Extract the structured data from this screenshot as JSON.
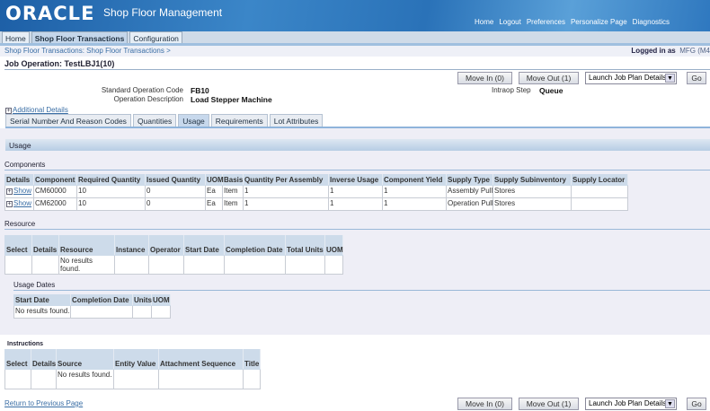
{
  "header": {
    "logo": "ORACLE",
    "app_title": "Shop Floor Management",
    "global_links": [
      "Home",
      "Logout",
      "Preferences",
      "Personalize Page",
      "Diagnostics"
    ]
  },
  "tabs": [
    {
      "label": "Home",
      "active": false
    },
    {
      "label": "Shop Floor Transactions",
      "active": true
    },
    {
      "label": "Configuration",
      "active": false
    }
  ],
  "breadcrumb": "Shop Floor Transactions: Shop Floor Transactions  >",
  "logged_in": {
    "label": "Logged in as",
    "user": "MFG (M4"
  },
  "page_title": "Job Operation: TestLBJ1(10)",
  "actions": {
    "move_in": "Move In (0)",
    "move_out": "Move Out (1)",
    "launch_select": "Launch Job Plan Details",
    "go": "Go"
  },
  "details": {
    "std_op_code_label": "Standard Operation Code",
    "std_op_code": "FB10",
    "op_desc_label": "Operation Description",
    "op_desc": "Load Stepper Machine",
    "intraop_label": "Intraop Step",
    "intraop": "Queue",
    "additional_details": "Additional Details"
  },
  "subtabs": [
    {
      "label": "Serial Number And Reason Codes"
    },
    {
      "label": "Quantities"
    },
    {
      "label": "Usage",
      "active": true
    },
    {
      "label": "Requirements"
    },
    {
      "label": "Lot Attributes"
    }
  ],
  "usage_header": "Usage",
  "components": {
    "title": "Components",
    "columns": [
      "Details",
      "Component",
      "Required Quantity",
      "Issued Quantity",
      "UOM",
      "Basis",
      "Quantity Per Assembly",
      "Inverse Usage",
      "Component Yield",
      "Supply Type",
      "Supply Subinventory",
      "Supply Locator"
    ],
    "rows": [
      {
        "details": "Show",
        "component": "CM60000",
        "required": "10",
        "issued": "0",
        "uom": "Ea",
        "basis": "Item",
        "qpa": "1",
        "inverse": "1",
        "yield": "1",
        "supply_type": "Assembly Pull",
        "subinv": "Stores",
        "locator": ""
      },
      {
        "details": "Show",
        "component": "CM62000",
        "required": "10",
        "issued": "0",
        "uom": "Ea",
        "basis": "Item",
        "qpa": "1",
        "inverse": "1",
        "yield": "1",
        "supply_type": "Operation Pull",
        "subinv": "Stores",
        "locator": ""
      }
    ]
  },
  "resource": {
    "title": "Resource",
    "columns": [
      "Select",
      "Details",
      "Resource",
      "Instance",
      "Operator",
      "Start Date",
      "Completion Date",
      "Total Units",
      "UOM"
    ],
    "empty": "No results found."
  },
  "usage_dates": {
    "title": "Usage Dates",
    "columns": [
      "Start Date",
      "Completion Date",
      "Units",
      "UOM"
    ],
    "empty": "No results found."
  },
  "instructions": {
    "title": "Instructions",
    "columns": [
      "Select",
      "Details",
      "Source",
      "Entity Value",
      "Attachment Sequence",
      "Title"
    ],
    "empty": "No results found."
  },
  "return_link": "Return to Previous Page"
}
